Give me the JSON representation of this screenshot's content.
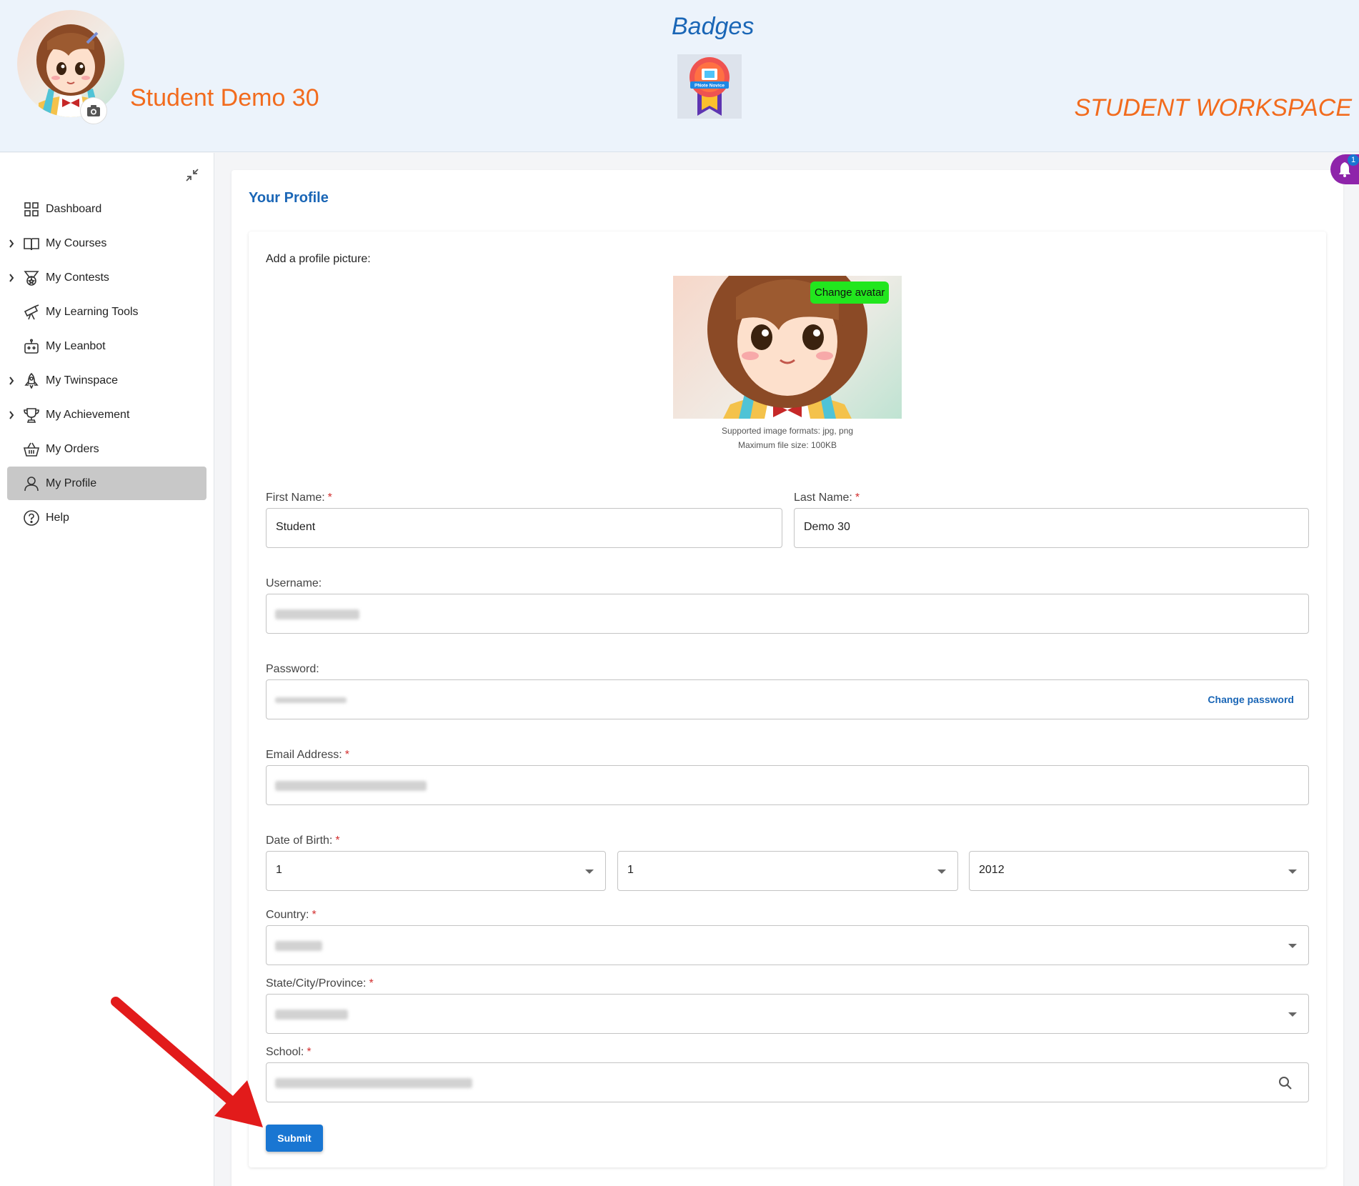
{
  "header": {
    "student_name": "Student Demo 30",
    "badges_title": "Badges",
    "badge_label": "PNote Novice",
    "workspace_label": "STUDENT WORKSPACE"
  },
  "sidebar": {
    "items": [
      {
        "label": "Dashboard",
        "icon": "grid-icon",
        "expandable": false,
        "active": false
      },
      {
        "label": "My Courses",
        "icon": "book-icon",
        "expandable": true,
        "active": false
      },
      {
        "label": "My Contests",
        "icon": "medal-icon",
        "expandable": true,
        "active": false
      },
      {
        "label": "My Learning Tools",
        "icon": "telescope-icon",
        "expandable": false,
        "active": false
      },
      {
        "label": "My Leanbot",
        "icon": "robot-icon",
        "expandable": false,
        "active": false
      },
      {
        "label": "My Twinspace",
        "icon": "rocket-icon",
        "expandable": true,
        "active": false
      },
      {
        "label": "My Achievement",
        "icon": "trophy-icon",
        "expandable": true,
        "active": false
      },
      {
        "label": "My Orders",
        "icon": "basket-icon",
        "expandable": false,
        "active": false
      },
      {
        "label": "My Profile",
        "icon": "person-icon",
        "expandable": false,
        "active": true
      },
      {
        "label": "Help",
        "icon": "help-icon",
        "expandable": false,
        "active": false
      }
    ]
  },
  "main": {
    "title": "Your Profile",
    "picture_label": "Add a profile picture:",
    "change_avatar": "Change avatar",
    "formats_note": "Supported image formats: jpg, png",
    "size_note": "Maximum file size: 100KB",
    "required_mark": "*",
    "first_name": {
      "label": "First Name:",
      "value": "Student"
    },
    "last_name": {
      "label": "Last Name:",
      "value": "Demo 30"
    },
    "username": {
      "label": "Username:"
    },
    "password": {
      "label": "Password:",
      "action": "Change password"
    },
    "email": {
      "label": "Email Address:"
    },
    "dob": {
      "label": "Date of Birth:",
      "day": "1",
      "month": "1",
      "year": "2012"
    },
    "country": {
      "label": "Country:"
    },
    "state": {
      "label": "State/City/Province:"
    },
    "school": {
      "label": "School:"
    },
    "submit_label": "Submit"
  },
  "notifications": {
    "count": "1"
  },
  "colors": {
    "accent_blue": "#1a66b6",
    "brand_orange": "#f26b1d",
    "avatar_button_green": "#22e61e",
    "submit_blue": "#1976d2",
    "notification_purple": "#8e24aa",
    "annotation_red": "#e21b1b"
  }
}
